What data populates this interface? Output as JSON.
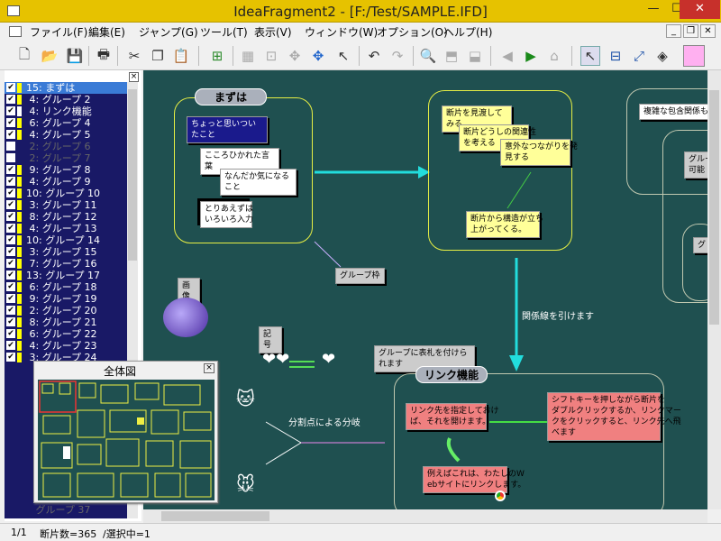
{
  "window": {
    "title": "IdeaFragment2 - [F:/Test/SAMPLE.IFD]",
    "min": "—",
    "max": "☐",
    "close": "✕"
  },
  "menu": [
    "ファイル(F)",
    "編集(E)",
    "ジャンプ(G)",
    "ツール(T)",
    "表示(V)",
    "ウィンドウ(W)",
    "オプション(O)",
    "ヘルプ(H)"
  ],
  "mdi": {
    "min": "_",
    "restore": "❐",
    "close": "✕"
  },
  "list_close": "×",
  "list": [
    {
      "label": "15: まずは",
      "check": "✔",
      "color": "#ffff00",
      "sel": true
    },
    {
      "label": " 4: グループ 2",
      "check": "✔",
      "color": "#ffff00"
    },
    {
      "label": " 4: リンク機能",
      "check": "✔",
      "color": "#ffffff"
    },
    {
      "label": " 6: グループ 4",
      "check": "✔",
      "color": "#ffff00"
    },
    {
      "label": " 4: グループ 5",
      "check": "✔",
      "color": "#ffff00"
    },
    {
      "label": " 2: グループ 6",
      "check": "",
      "color": "#191966",
      "dim": true
    },
    {
      "label": " 2: グループ 7",
      "check": "",
      "color": "#191966",
      "dim": true
    },
    {
      "label": " 9: グループ 8",
      "check": "✔",
      "color": "#ffff00"
    },
    {
      "label": " 4: グループ 9",
      "check": "✔",
      "color": "#ffff00"
    },
    {
      "label": "10: グループ 10",
      "check": "✔",
      "color": "#ffff00"
    },
    {
      "label": " 3: グループ 11",
      "check": "✔",
      "color": "#ffff00"
    },
    {
      "label": " 8: グループ 12",
      "check": "✔",
      "color": "#ffff00"
    },
    {
      "label": " 4: グループ 13",
      "check": "✔",
      "color": "#ffff00"
    },
    {
      "label": "10: グループ 14",
      "check": "✔",
      "color": "#ffff00"
    },
    {
      "label": " 3: グループ 15",
      "check": "✔",
      "color": "#ffff00"
    },
    {
      "label": " 7: グループ 16",
      "check": "✔",
      "color": "#ffff00"
    },
    {
      "label": "13: グループ 17",
      "check": "✔",
      "color": "#ffff00"
    },
    {
      "label": " 6: グループ 18",
      "check": "✔",
      "color": "#ffff00"
    },
    {
      "label": " 9: グループ 19",
      "check": "✔",
      "color": "#ffff00"
    },
    {
      "label": " 2: グループ 20",
      "check": "✔",
      "color": "#ffff00"
    },
    {
      "label": " 8: グループ 21",
      "check": "✔",
      "color": "#ffff00"
    },
    {
      "label": " 6: グループ 22",
      "check": "✔",
      "color": "#ffff00"
    },
    {
      "label": " 4: グループ 23",
      "check": "✔",
      "color": "#ffff00"
    },
    {
      "label": " 3: グループ 24",
      "check": "✔",
      "color": "#ffff00"
    }
  ],
  "list_last": "   グループ 37",
  "canvas": {
    "g1": {
      "label": "まずは",
      "c1": "ちょっと思いついたこと",
      "c2": "こころひかれた言葉",
      "c3": "なんだか気になること",
      "c4": "とりあえずは\nいろいろ入力"
    },
    "g2": {
      "c1": "断片を見渡してみる",
      "c2": "断片どうしの関連性\nを考える",
      "c3": "意外なつながりを発\n見する",
      "c4": "断片から構造が立ち\n上がってくる。"
    },
    "g3": {
      "c1": "複雑な包含関係も",
      "c2": "グルー\n可能",
      "c3": "グ"
    },
    "gwaku": "グループ枠",
    "gazou": "画像",
    "kigou": "記号",
    "fuda": "グループに表札を付けられます",
    "kankei": "関係線を引けます",
    "bunki": "分割点による分岐",
    "link": {
      "label": "リンク機能",
      "c1": "リンク先を指定しておけ\nば、それを開けます。",
      "c2": "シフトキーを押しながら断片を\nダブルクリックするか、リンクマー\nクをクリックすると、リンク先へ飛\nべます",
      "c3": "例えばこれは、わたしのW\nebサイトにリンクします。"
    }
  },
  "overview": {
    "title": "全体図",
    "close": "×"
  },
  "status": {
    "page": "1/1",
    "count": "断片数=365",
    "sel": "/選択中=1"
  }
}
